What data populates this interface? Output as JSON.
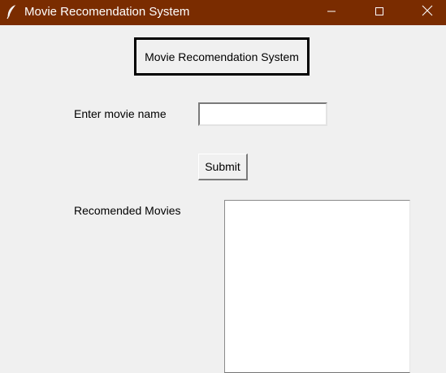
{
  "window": {
    "title": "Movie Recomendation System",
    "titlebar_color": "#7a2c00",
    "icon": "feather-icon",
    "controls": {
      "minimize": "minimize-icon",
      "maximize": "maximize-icon",
      "close": "close-icon"
    }
  },
  "main": {
    "heading": "Movie Recomendation System",
    "movie_label": "Enter movie name",
    "movie_input_value": "",
    "submit_label": "Submit",
    "results_label": "Recomended Movies",
    "results_text": ""
  }
}
